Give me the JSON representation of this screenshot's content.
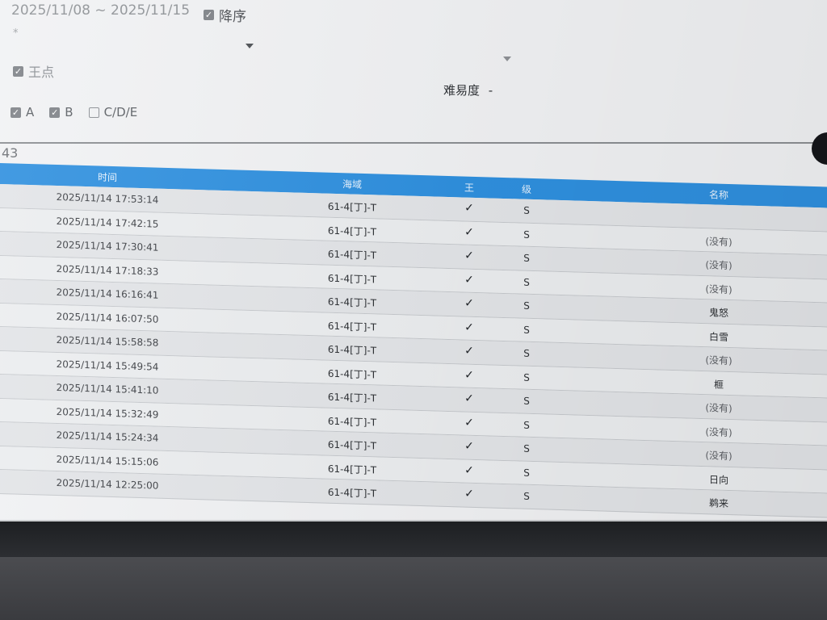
{
  "filters": {
    "date_start": "2025/11/08",
    "date_sep": "~",
    "date_end": "2025/11/15",
    "descending_label": "降序",
    "descending_checked": true,
    "asterisk": "*",
    "king_label": "王点",
    "king_checked": true,
    "difficulty_label": "难易度",
    "difficulty_value": "-",
    "grades": [
      {
        "label": "A",
        "checked": true
      },
      {
        "label": "B",
        "checked": true
      },
      {
        "label": "C/D/E",
        "checked": false
      }
    ]
  },
  "result_count": "43",
  "table": {
    "headers": {
      "time": "时间",
      "sea": "海域",
      "king": "王",
      "level": "级",
      "name": "名称"
    },
    "rows": [
      {
        "time": "2025/11/14 17:53:14",
        "sea": "61-4[丁]-T",
        "king": "✓",
        "level": "S",
        "name": ""
      },
      {
        "time": "2025/11/14 17:42:15",
        "sea": "61-4[丁]-T",
        "king": "✓",
        "level": "S",
        "name": "(没有)"
      },
      {
        "time": "2025/11/14 17:30:41",
        "sea": "61-4[丁]-T",
        "king": "✓",
        "level": "S",
        "name": "(没有)"
      },
      {
        "time": "2025/11/14 17:18:33",
        "sea": "61-4[丁]-T",
        "king": "✓",
        "level": "S",
        "name": "(没有)"
      },
      {
        "time": "2025/11/14 16:16:41",
        "sea": "61-4[丁]-T",
        "king": "✓",
        "level": "S",
        "name": "鬼怒"
      },
      {
        "time": "2025/11/14 16:07:50",
        "sea": "61-4[丁]-T",
        "king": "✓",
        "level": "S",
        "name": "白雪"
      },
      {
        "time": "2025/11/14 15:58:58",
        "sea": "61-4[丁]-T",
        "king": "✓",
        "level": "S",
        "name": "(没有)"
      },
      {
        "time": "2025/11/14 15:49:54",
        "sea": "61-4[丁]-T",
        "king": "✓",
        "level": "S",
        "name": "榧"
      },
      {
        "time": "2025/11/14 15:41:10",
        "sea": "61-4[丁]-T",
        "king": "✓",
        "level": "S",
        "name": "(没有)"
      },
      {
        "time": "2025/11/14 15:32:49",
        "sea": "61-4[丁]-T",
        "king": "✓",
        "level": "S",
        "name": "(没有)"
      },
      {
        "time": "2025/11/14 15:24:34",
        "sea": "61-4[丁]-T",
        "king": "✓",
        "level": "S",
        "name": "(没有)"
      },
      {
        "time": "2025/11/14 15:15:06",
        "sea": "61-4[丁]-T",
        "king": "✓",
        "level": "S",
        "name": "日向"
      },
      {
        "time": "2025/11/14 12:25:00",
        "sea": "61-4[丁]-T",
        "king": "✓",
        "level": "S",
        "name": "鹈来"
      }
    ]
  },
  "colors": {
    "header_bg": "#2f90df",
    "header_text": "#e9f4ff",
    "row_text": "#2c2f33"
  }
}
